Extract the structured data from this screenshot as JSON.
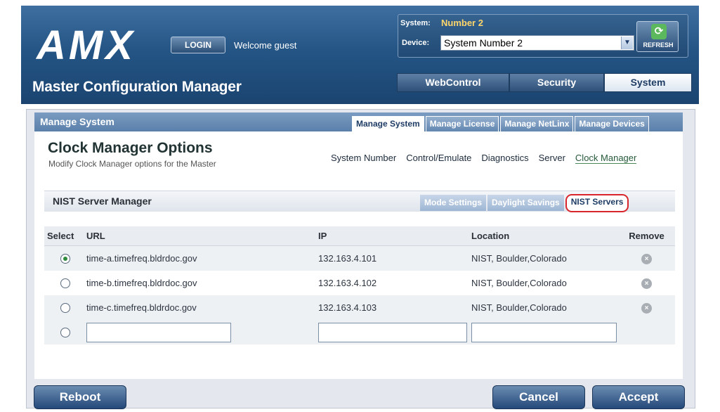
{
  "header": {
    "logo_text": "AMX",
    "login_label": "LOGIN",
    "welcome_text": "Welcome guest",
    "app_title": "Master Configuration Manager",
    "system_label": "System:",
    "system_value": "Number 2",
    "device_label": "Device:",
    "device_value": "System Number 2",
    "refresh_label": "REFRESH",
    "main_tabs": [
      {
        "label": "WebControl"
      },
      {
        "label": "Security"
      },
      {
        "label": "System"
      }
    ],
    "active_main_tab": "System"
  },
  "panel": {
    "title": "Manage System",
    "tabs": [
      {
        "label": "Manage System"
      },
      {
        "label": "Manage License"
      },
      {
        "label": "Manage NetLinx"
      },
      {
        "label": "Manage Devices"
      }
    ],
    "active_tab": "Manage System"
  },
  "page": {
    "title": "Clock Manager Options",
    "subtitle": "Modify Clock Manager options for the Master",
    "links": [
      {
        "label": "System Number"
      },
      {
        "label": "Control/Emulate"
      },
      {
        "label": "Diagnostics"
      },
      {
        "label": "Server"
      },
      {
        "label": "Clock Manager"
      }
    ],
    "active_link": "Clock Manager"
  },
  "section": {
    "title": "NIST Server Manager",
    "tabs": [
      {
        "label": "Mode Settings"
      },
      {
        "label": "Daylight Savings"
      },
      {
        "label": "NIST Servers"
      }
    ],
    "active_tab": "NIST Servers",
    "highlight_color": "#d9262c"
  },
  "grid": {
    "headers": {
      "select": "Select",
      "url": "URL",
      "ip": "IP",
      "location": "Location",
      "remove": "Remove"
    },
    "rows": [
      {
        "selected": true,
        "url": "time-a.timefreq.bldrdoc.gov",
        "ip": "132.163.4.101",
        "location": "NIST, Boulder,Colorado"
      },
      {
        "selected": false,
        "url": "time-b.timefreq.bldrdoc.gov",
        "ip": "132.163.4.102",
        "location": "NIST, Boulder,Colorado"
      },
      {
        "selected": false,
        "url": "time-c.timefreq.bldrdoc.gov",
        "ip": "132.163.4.103",
        "location": "NIST, Boulder,Colorado"
      }
    ],
    "new_row": {
      "url": "",
      "ip": "",
      "location": ""
    }
  },
  "footer": {
    "reboot_label": "Reboot",
    "cancel_label": "Cancel",
    "accept_label": "Accept"
  }
}
